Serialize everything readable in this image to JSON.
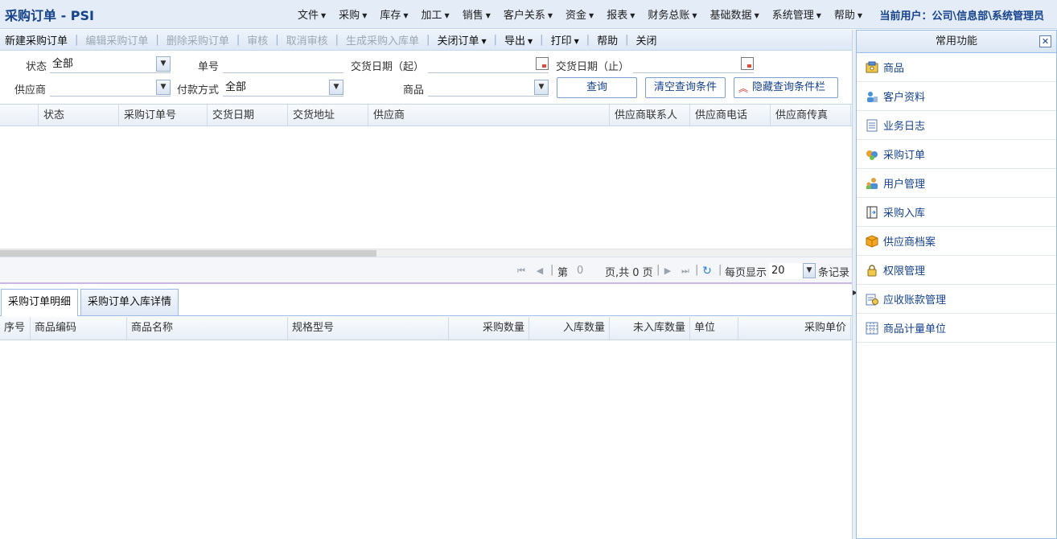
{
  "app": {
    "title": "采购订单 - PSI",
    "current_user": "当前用户：公司\\信息部\\系统管理员"
  },
  "menu": [
    "文件",
    "采购",
    "库存",
    "加工",
    "销售",
    "客户关系",
    "资金",
    "报表",
    "财务总账",
    "基础数据",
    "系统管理",
    "帮助"
  ],
  "toolbar": {
    "new": "新建采购订单",
    "edit": "编辑采购订单",
    "delete": "删除采购订单",
    "audit": "审核",
    "cancel_audit": "取消审核",
    "gen_inbound": "生成采购入库单",
    "close_order": "关闭订单",
    "export": "导出",
    "print": "打印",
    "help": "帮助",
    "close": "关闭"
  },
  "query": {
    "status_label": "状态",
    "status_value": "全部",
    "ref_label": "单号",
    "ref_value": "",
    "deal_from_label": "交货日期（起）",
    "deal_from_value": "",
    "deal_to_label": "交货日期（止）",
    "deal_to_value": "",
    "supplier_label": "供应商",
    "supplier_value": "",
    "payment_label": "付款方式",
    "payment_value": "全部",
    "goods_label": "商品",
    "goods_value": "",
    "query_btn": "查询",
    "clear_btn": "清空查询条件",
    "hide_btn": "隐藏查询条件栏"
  },
  "grid1": {
    "columns": [
      "状态",
      "采购订单号",
      "交货日期",
      "交货地址",
      "供应商",
      "供应商联系人",
      "供应商电话",
      "供应商传真"
    ]
  },
  "pager": {
    "page_prefix": "第",
    "page_value": "0",
    "page_suffix": "页,共 0 页",
    "per_page_label": "每页显示",
    "per_page_value": "20",
    "records_label": "条记录"
  },
  "tabs": [
    "采购订单明细",
    "采购订单入库详情"
  ],
  "grid2": {
    "columns": [
      "序号",
      "商品编码",
      "商品名称",
      "规格型号",
      "采购数量",
      "入库数量",
      "未入库数量",
      "单位",
      "采购单价"
    ]
  },
  "quick": {
    "title": "常用功能",
    "items": [
      {
        "label": "商品",
        "icon": "goods-icon"
      },
      {
        "label": "客户资料",
        "icon": "customer-icon"
      },
      {
        "label": "业务日志",
        "icon": "log-icon"
      },
      {
        "label": "采购订单",
        "icon": "purchase-order-icon"
      },
      {
        "label": "用户管理",
        "icon": "user-management-icon"
      },
      {
        "label": "采购入库",
        "icon": "inbound-icon"
      },
      {
        "label": "供应商档案",
        "icon": "supplier-icon"
      },
      {
        "label": "权限管理",
        "icon": "lock-icon"
      },
      {
        "label": "应收账款管理",
        "icon": "receivables-icon"
      },
      {
        "label": "商品计量单位",
        "icon": "unit-icon"
      }
    ]
  }
}
